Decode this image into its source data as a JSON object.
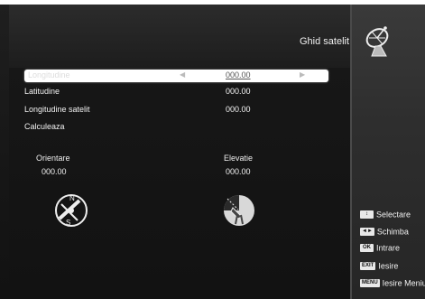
{
  "header": {
    "title": "Ghid satelit",
    "icon": "satellite-dish-icon"
  },
  "fields": [
    {
      "label": "Longitudine",
      "value": "000.00",
      "selected": true
    },
    {
      "label": "Latitudine",
      "value": "000.00",
      "selected": false
    },
    {
      "label": "Longitudine satelit",
      "value": "000.00",
      "selected": false
    },
    {
      "label": "Calculeaza",
      "value": "",
      "selected": false
    }
  ],
  "results": {
    "orientare": {
      "label": "Orientare",
      "value": "000.00",
      "icon": "compass-icon"
    },
    "elevatie": {
      "label": "Elevatie",
      "value": "000.00",
      "icon": "elevation-dish-icon"
    }
  },
  "legend": [
    {
      "key": "↕",
      "text": "Selectare"
    },
    {
      "key": "◄►",
      "text": "Schimba"
    },
    {
      "key": "OK",
      "text": "Intrare"
    },
    {
      "key": "EXIT",
      "text": "Iesire"
    },
    {
      "key": "MENU",
      "text": "Iesire Meniu"
    }
  ]
}
